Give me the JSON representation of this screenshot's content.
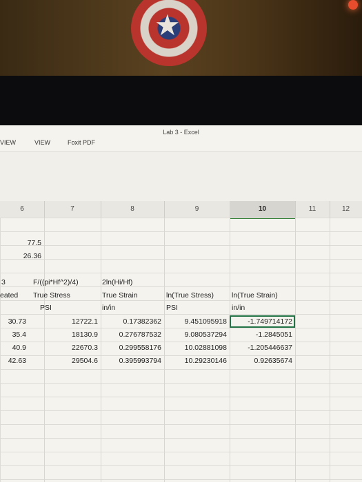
{
  "window": {
    "title": "Lab 3 - Excel"
  },
  "ribbon_tabs": [
    "VIEW",
    "VIEW",
    "Foxit PDF"
  ],
  "column_headers": [
    "6",
    "7",
    "8",
    "9",
    "10",
    "11",
    "12"
  ],
  "selected_column": "10",
  "misc_values": {
    "v1": "77.5",
    "v2": "26.36"
  },
  "headers": {
    "row_a": {
      "col6_partial": "3",
      "col7": "F/((pi*Hf^2)/4)",
      "col8": "2ln(Hi/Hf)"
    },
    "row_b": {
      "col6_partial": "eated",
      "col7": "True Stress",
      "col8": "True Strain",
      "col9": "ln(True Stress)",
      "col10": "ln(True Strain)"
    },
    "row_c": {
      "col7": "PSI",
      "col8": "in/in",
      "col9": "PSI",
      "col10": "in/in"
    }
  },
  "rows": [
    {
      "c6": "30.73",
      "c7": "12722.1",
      "c8": "0.17382362",
      "c9": "9.451095918",
      "c10": "-1.749714172"
    },
    {
      "c6": "35.4",
      "c7": "18130.9",
      "c8": "0.276787532",
      "c9": "9.080537294",
      "c10": "-1.2845051"
    },
    {
      "c6": "40.9",
      "c7": "22670.3",
      "c8": "0.299558176",
      "c9": "10.02881098",
      "c10": "-1.205446637"
    },
    {
      "c6": "42.63",
      "c7": "29504.6",
      "c8": "0.395993794",
      "c9": "10.29230146",
      "c10": "0.92635674"
    }
  ],
  "colors": {
    "selection": "#217346",
    "sheet_bg": "#f4f3ee"
  }
}
